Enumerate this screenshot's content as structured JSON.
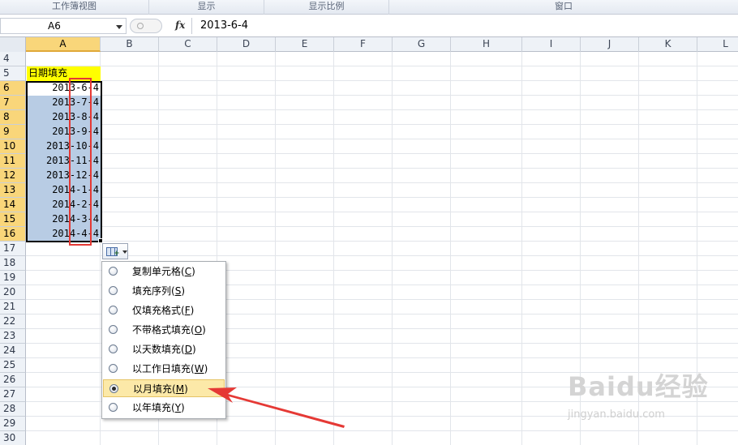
{
  "ribbon": {
    "groups": [
      "工作簿视图",
      "显示",
      "显示比例",
      "窗口"
    ]
  },
  "formula_bar": {
    "name_box": "A6",
    "fx": "fx",
    "formula": "2013-6-4"
  },
  "columns": [
    "A",
    "B",
    "C",
    "D",
    "E",
    "F",
    "G",
    "H",
    "I",
    "J",
    "K",
    "L"
  ],
  "rows": [
    "4",
    "5",
    "6",
    "7",
    "8",
    "9",
    "10",
    "11",
    "12",
    "13",
    "14",
    "15",
    "16",
    "17",
    "18",
    "19",
    "20",
    "21",
    "22",
    "23",
    "24",
    "25",
    "26",
    "27",
    "28",
    "29",
    "30"
  ],
  "sheet": {
    "a5_header": "日期填充",
    "dates": [
      "2013-6-4",
      "2013-7-4",
      "2013-8-4",
      "2013-9-4",
      "2013-10-4",
      "2013-11-4",
      "2013-12-4",
      "2014-1-4",
      "2014-2-4",
      "2014-3-4",
      "2014-4-4"
    ]
  },
  "autofill_menu": {
    "items": [
      {
        "label": "复制单元格",
        "key": "C",
        "checked": false
      },
      {
        "label": "填充序列",
        "key": "S",
        "checked": false
      },
      {
        "label": "仅填充格式",
        "key": "F",
        "checked": false
      },
      {
        "label": "不带格式填充",
        "key": "O",
        "checked": false
      },
      {
        "label": "以天数填充",
        "key": "D",
        "checked": false
      },
      {
        "label": "以工作日填充",
        "key": "W",
        "checked": false
      },
      {
        "label": "以月填充",
        "key": "M",
        "checked": true
      },
      {
        "label": "以年填充",
        "key": "Y",
        "checked": false
      }
    ]
  },
  "colors": {
    "header_fill": "#ffff00",
    "selection_fill": "#b8cce4",
    "selected_header": "#f9d67a",
    "annotation": "#e53935"
  },
  "watermark": {
    "main": "Baidu经验",
    "sub": "jingyan.baidu.com"
  }
}
